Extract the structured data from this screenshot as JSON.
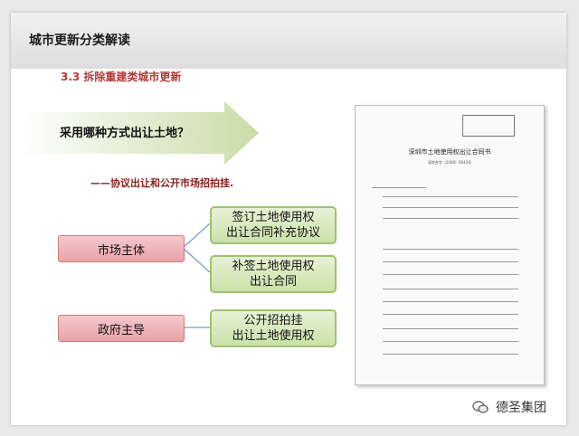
{
  "header": {
    "title": "城市更新分类解读"
  },
  "section_title": "3.3 拆除重建类城市更新",
  "question": "采用哪种方式出让土地？",
  "subtitle": "——协议出让和公开市场招拍挂.",
  "left_boxes": [
    "市场主体",
    "政府主导"
  ],
  "right_boxes": [
    {
      "line1": "签订土地使用权",
      "line2": "出让合同补充协议"
    },
    {
      "line1": "补签土地使用权",
      "line2": "出让合同"
    },
    {
      "line1": "公开招拍挂",
      "line2": "出让土地使用权"
    }
  ],
  "doc": {
    "title": "深圳市土地使用权出让合同书",
    "number": "深地合字（2008）0043号"
  },
  "brand": "德圣集团",
  "colors": {
    "pink": "#e9a3a8",
    "green": "#c9e2a8",
    "red_text": "#b33a3a"
  }
}
